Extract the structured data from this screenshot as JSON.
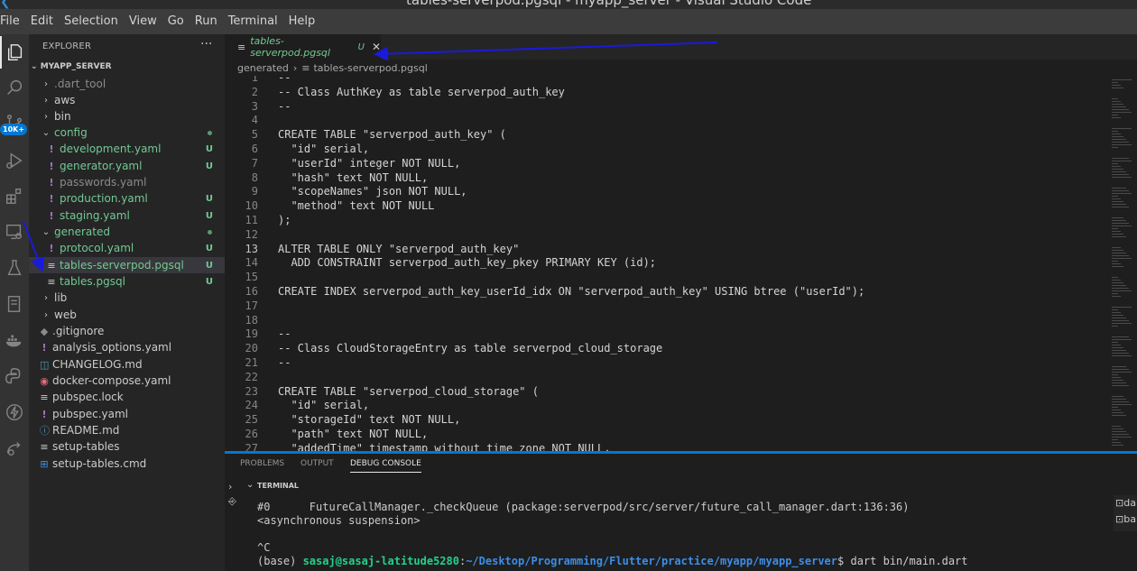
{
  "window_title": "tables-serverpod.pgsql - myapp_server - Visual Studio Code",
  "menu": [
    "File",
    "Edit",
    "Selection",
    "View",
    "Go",
    "Run",
    "Terminal",
    "Help"
  ],
  "activity_badge": "10K+",
  "explorer": {
    "title": "EXPLORER",
    "more": "···",
    "section": "MYAPP_SERVER",
    "items": [
      {
        "label": ".dart_tool",
        "status": ""
      },
      {
        "label": "aws",
        "status": ""
      },
      {
        "label": "bin",
        "status": ""
      },
      {
        "label": "config",
        "status": ""
      },
      {
        "label": "development.yaml",
        "status": "U"
      },
      {
        "label": "generator.yaml",
        "status": "U"
      },
      {
        "label": "passwords.yaml",
        "status": ""
      },
      {
        "label": "production.yaml",
        "status": "U"
      },
      {
        "label": "staging.yaml",
        "status": "U"
      },
      {
        "label": "generated",
        "status": ""
      },
      {
        "label": "protocol.yaml",
        "status": "U"
      },
      {
        "label": "tables-serverpod.pgsql",
        "status": "U"
      },
      {
        "label": "tables.pgsql",
        "status": "U"
      },
      {
        "label": "lib",
        "status": ""
      },
      {
        "label": "web",
        "status": ""
      },
      {
        "label": ".gitignore",
        "status": ""
      },
      {
        "label": "analysis_options.yaml",
        "status": ""
      },
      {
        "label": "CHANGELOG.md",
        "status": ""
      },
      {
        "label": "docker-compose.yaml",
        "status": ""
      },
      {
        "label": "pubspec.lock",
        "status": ""
      },
      {
        "label": "pubspec.yaml",
        "status": ""
      },
      {
        "label": "README.md",
        "status": ""
      },
      {
        "label": "setup-tables",
        "status": ""
      },
      {
        "label": "setup-tables.cmd",
        "status": ""
      }
    ]
  },
  "editor": {
    "tab_label": "tables-serverpod.pgsql",
    "tab_status": "U",
    "breadcrumb": [
      "generated",
      "tables-serverpod.pgsql"
    ],
    "lines": [
      {
        "n": "1",
        "t": "--"
      },
      {
        "n": "2",
        "t": "-- Class AuthKey as table serverpod_auth_key"
      },
      {
        "n": "3",
        "t": "--"
      },
      {
        "n": "4",
        "t": ""
      },
      {
        "n": "5",
        "t": "CREATE TABLE \"serverpod_auth_key\" ("
      },
      {
        "n": "6",
        "t": "  \"id\" serial,"
      },
      {
        "n": "7",
        "t": "  \"userId\" integer NOT NULL,"
      },
      {
        "n": "8",
        "t": "  \"hash\" text NOT NULL,"
      },
      {
        "n": "9",
        "t": "  \"scopeNames\" json NOT NULL,"
      },
      {
        "n": "10",
        "t": "  \"method\" text NOT NULL"
      },
      {
        "n": "11",
        "t": ");"
      },
      {
        "n": "12",
        "t": ""
      },
      {
        "n": "13",
        "t": "ALTER TABLE ONLY \"serverpod_auth_key\""
      },
      {
        "n": "14",
        "t": "  ADD CONSTRAINT serverpod_auth_key_pkey PRIMARY KEY (id);"
      },
      {
        "n": "15",
        "t": ""
      },
      {
        "n": "16",
        "t": "CREATE INDEX serverpod_auth_key_userId_idx ON \"serverpod_auth_key\" USING btree (\"userId\");"
      },
      {
        "n": "17",
        "t": ""
      },
      {
        "n": "18",
        "t": ""
      },
      {
        "n": "19",
        "t": "--"
      },
      {
        "n": "20",
        "t": "-- Class CloudStorageEntry as table serverpod_cloud_storage"
      },
      {
        "n": "21",
        "t": "--"
      },
      {
        "n": "22",
        "t": ""
      },
      {
        "n": "23",
        "t": "CREATE TABLE \"serverpod_cloud_storage\" ("
      },
      {
        "n": "24",
        "t": "  \"id\" serial,"
      },
      {
        "n": "25",
        "t": "  \"storageId\" text NOT NULL,"
      },
      {
        "n": "26",
        "t": "  \"path\" text NOT NULL,"
      },
      {
        "n": "27",
        "t": "  \"addedTime\" timestamp without time zone NOT NULL,"
      }
    ]
  },
  "panel": {
    "tabs": [
      "PROBLEMS",
      "OUTPUT",
      "DEBUG CONSOLE"
    ],
    "terminal_header": "TERMINAL",
    "terminal_lines": {
      "l1": "#0      FutureCallManager._checkQueue (package:serverpod/src/server/future_call_manager.dart:136:36)",
      "l2": "<asynchronous suspension>",
      "l3": "^C",
      "prompt_env": "(base) ",
      "prompt_user": "sasaj@sasaj-latitude5280",
      "prompt_sep": ":",
      "prompt_path": "~/Desktop/Programming/Flutter/practice/myapp/myapp_server",
      "prompt_cmd": "$ dart bin/main.dart"
    },
    "terminal_list": [
      "da",
      "ba"
    ]
  },
  "colors": {
    "accent": "#0078d4",
    "untracked": "#73c991",
    "annotation_arrow": "#1a1adb"
  }
}
